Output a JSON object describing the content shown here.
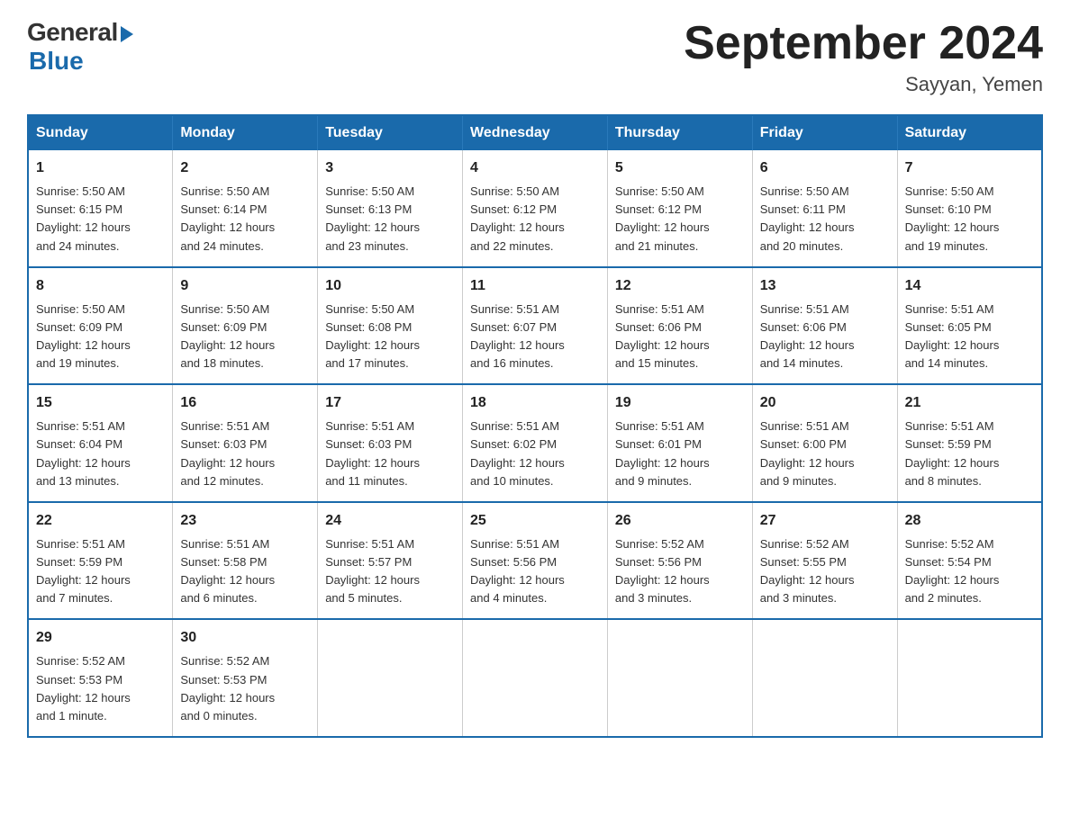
{
  "logo": {
    "general": "General",
    "blue": "Blue"
  },
  "title": "September 2024",
  "location": "Sayyan, Yemen",
  "days_of_week": [
    "Sunday",
    "Monday",
    "Tuesday",
    "Wednesday",
    "Thursday",
    "Friday",
    "Saturday"
  ],
  "weeks": [
    [
      {
        "day": "1",
        "sunrise": "5:50 AM",
        "sunset": "6:15 PM",
        "daylight": "12 hours and 24 minutes."
      },
      {
        "day": "2",
        "sunrise": "5:50 AM",
        "sunset": "6:14 PM",
        "daylight": "12 hours and 24 minutes."
      },
      {
        "day": "3",
        "sunrise": "5:50 AM",
        "sunset": "6:13 PM",
        "daylight": "12 hours and 23 minutes."
      },
      {
        "day": "4",
        "sunrise": "5:50 AM",
        "sunset": "6:12 PM",
        "daylight": "12 hours and 22 minutes."
      },
      {
        "day": "5",
        "sunrise": "5:50 AM",
        "sunset": "6:12 PM",
        "daylight": "12 hours and 21 minutes."
      },
      {
        "day": "6",
        "sunrise": "5:50 AM",
        "sunset": "6:11 PM",
        "daylight": "12 hours and 20 minutes."
      },
      {
        "day": "7",
        "sunrise": "5:50 AM",
        "sunset": "6:10 PM",
        "daylight": "12 hours and 19 minutes."
      }
    ],
    [
      {
        "day": "8",
        "sunrise": "5:50 AM",
        "sunset": "6:09 PM",
        "daylight": "12 hours and 19 minutes."
      },
      {
        "day": "9",
        "sunrise": "5:50 AM",
        "sunset": "6:09 PM",
        "daylight": "12 hours and 18 minutes."
      },
      {
        "day": "10",
        "sunrise": "5:50 AM",
        "sunset": "6:08 PM",
        "daylight": "12 hours and 17 minutes."
      },
      {
        "day": "11",
        "sunrise": "5:51 AM",
        "sunset": "6:07 PM",
        "daylight": "12 hours and 16 minutes."
      },
      {
        "day": "12",
        "sunrise": "5:51 AM",
        "sunset": "6:06 PM",
        "daylight": "12 hours and 15 minutes."
      },
      {
        "day": "13",
        "sunrise": "5:51 AM",
        "sunset": "6:06 PM",
        "daylight": "12 hours and 14 minutes."
      },
      {
        "day": "14",
        "sunrise": "5:51 AM",
        "sunset": "6:05 PM",
        "daylight": "12 hours and 14 minutes."
      }
    ],
    [
      {
        "day": "15",
        "sunrise": "5:51 AM",
        "sunset": "6:04 PM",
        "daylight": "12 hours and 13 minutes."
      },
      {
        "day": "16",
        "sunrise": "5:51 AM",
        "sunset": "6:03 PM",
        "daylight": "12 hours and 12 minutes."
      },
      {
        "day": "17",
        "sunrise": "5:51 AM",
        "sunset": "6:03 PM",
        "daylight": "12 hours and 11 minutes."
      },
      {
        "day": "18",
        "sunrise": "5:51 AM",
        "sunset": "6:02 PM",
        "daylight": "12 hours and 10 minutes."
      },
      {
        "day": "19",
        "sunrise": "5:51 AM",
        "sunset": "6:01 PM",
        "daylight": "12 hours and 9 minutes."
      },
      {
        "day": "20",
        "sunrise": "5:51 AM",
        "sunset": "6:00 PM",
        "daylight": "12 hours and 9 minutes."
      },
      {
        "day": "21",
        "sunrise": "5:51 AM",
        "sunset": "5:59 PM",
        "daylight": "12 hours and 8 minutes."
      }
    ],
    [
      {
        "day": "22",
        "sunrise": "5:51 AM",
        "sunset": "5:59 PM",
        "daylight": "12 hours and 7 minutes."
      },
      {
        "day": "23",
        "sunrise": "5:51 AM",
        "sunset": "5:58 PM",
        "daylight": "12 hours and 6 minutes."
      },
      {
        "day": "24",
        "sunrise": "5:51 AM",
        "sunset": "5:57 PM",
        "daylight": "12 hours and 5 minutes."
      },
      {
        "day": "25",
        "sunrise": "5:51 AM",
        "sunset": "5:56 PM",
        "daylight": "12 hours and 4 minutes."
      },
      {
        "day": "26",
        "sunrise": "5:52 AM",
        "sunset": "5:56 PM",
        "daylight": "12 hours and 3 minutes."
      },
      {
        "day": "27",
        "sunrise": "5:52 AM",
        "sunset": "5:55 PM",
        "daylight": "12 hours and 3 minutes."
      },
      {
        "day": "28",
        "sunrise": "5:52 AM",
        "sunset": "5:54 PM",
        "daylight": "12 hours and 2 minutes."
      }
    ],
    [
      {
        "day": "29",
        "sunrise": "5:52 AM",
        "sunset": "5:53 PM",
        "daylight": "12 hours and 1 minute."
      },
      {
        "day": "30",
        "sunrise": "5:52 AM",
        "sunset": "5:53 PM",
        "daylight": "12 hours and 0 minutes."
      },
      null,
      null,
      null,
      null,
      null
    ]
  ],
  "labels": {
    "sunrise": "Sunrise:",
    "sunset": "Sunset:",
    "daylight": "Daylight:"
  }
}
